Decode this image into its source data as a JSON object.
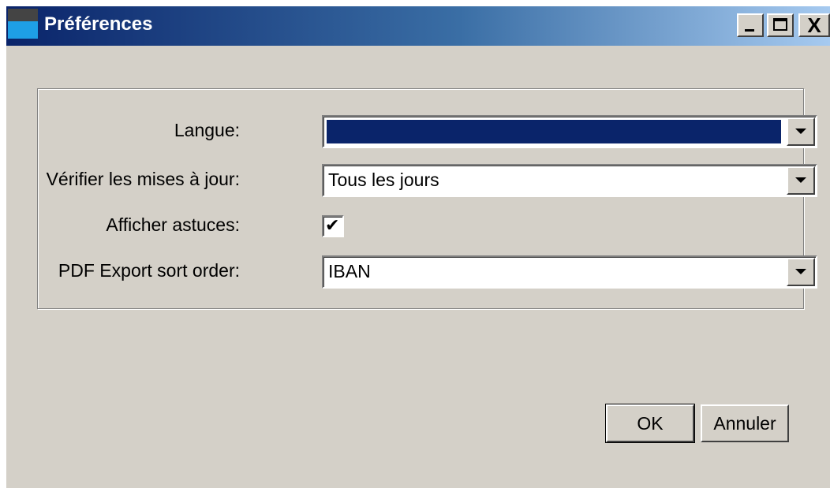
{
  "window": {
    "title": "Préférences",
    "controls": {
      "minimize": "_",
      "close": "X"
    }
  },
  "form": {
    "language": {
      "label": "Langue:",
      "value": ""
    },
    "updates": {
      "label": "Vérifier les mises à jour:",
      "value": "Tous les jours"
    },
    "tips": {
      "label": "Afficher astuces:",
      "checked": true,
      "check_glyph": "✔"
    },
    "pdf_sort": {
      "label": "PDF Export sort order:",
      "value": "IBAN"
    }
  },
  "buttons": {
    "ok": "OK",
    "cancel": "Annuler"
  },
  "colors": {
    "selection": "#0a246a",
    "face": "#d4d0c8"
  }
}
